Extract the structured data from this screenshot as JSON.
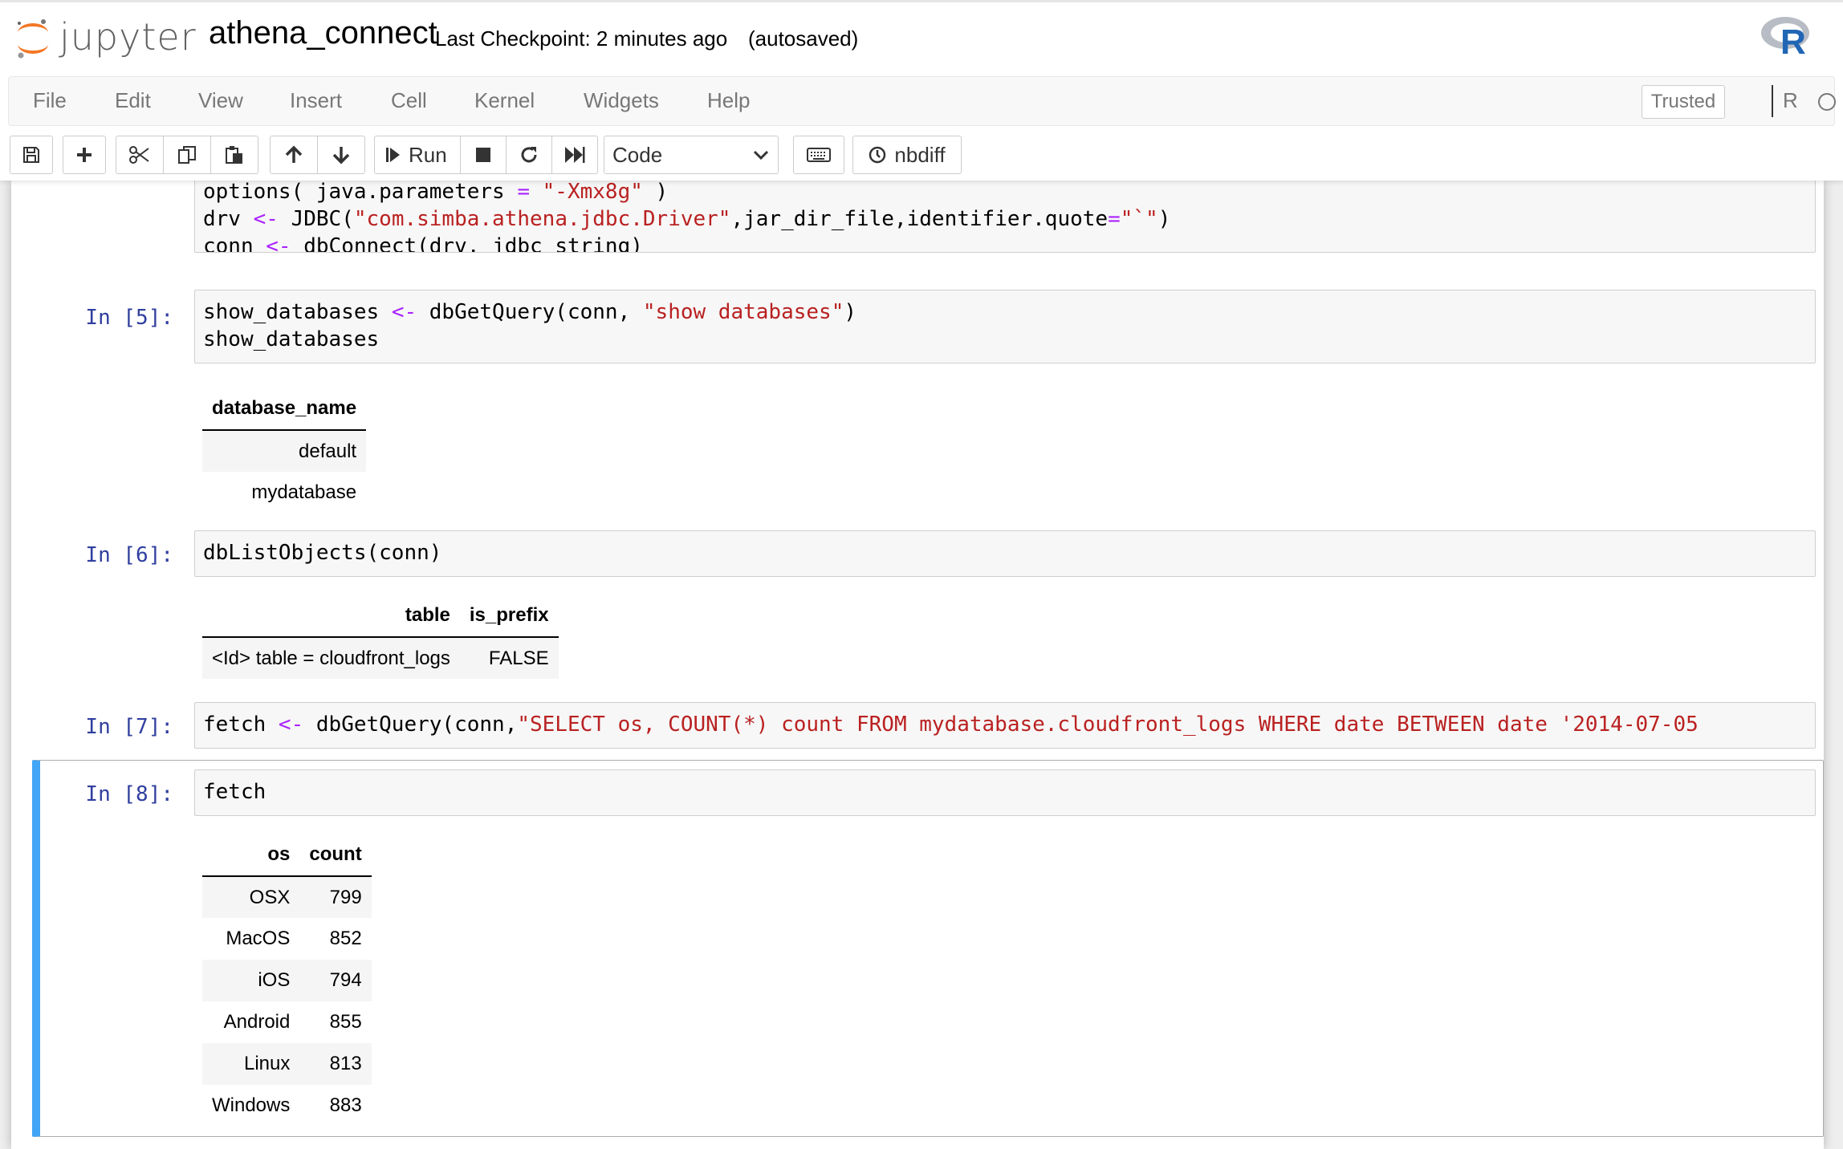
{
  "header": {
    "logo_text": "jupyter",
    "notebook_name": "athena_connect",
    "checkpoint": "Last Checkpoint: 2 minutes ago",
    "autosave": "(autosaved)",
    "kernel_logo_icon": "r-logo-icon"
  },
  "menubar": {
    "items": [
      "File",
      "Edit",
      "View",
      "Insert",
      "Cell",
      "Kernel",
      "Widgets",
      "Help"
    ],
    "trusted": "Trusted",
    "kernel_name": "R"
  },
  "toolbar": {
    "run_label": "Run",
    "cell_type": "Code",
    "nbdiff_label": "nbdiff"
  },
  "cells": {
    "c4": {
      "lines": [
        "options( java.parameters = \"-Xmx8g\" )",
        "drv <- JDBC(\"com.simba.athena.jdbc.Driver\",jar_dir_file,identifier.quote=\"`\")",
        "conn <- dbConnect(drv, jdbc_string)"
      ]
    },
    "c5": {
      "prompt": "In [5]:",
      "lines": [
        "show_databases <- dbGetQuery(conn, \"show databases\")",
        "show_databases"
      ],
      "output": {
        "columns": [
          "database_name"
        ],
        "rows": [
          [
            "default"
          ],
          [
            "mydatabase"
          ]
        ]
      }
    },
    "c6": {
      "prompt": "In [6]:",
      "lines": [
        "dbListObjects(conn)"
      ],
      "output": {
        "columns": [
          "table",
          "is_prefix"
        ],
        "rows": [
          [
            "<Id> table = cloudfront_logs",
            "FALSE"
          ]
        ]
      }
    },
    "c7": {
      "prompt": "In [7]:",
      "lines": [
        "fetch <- dbGetQuery(conn,\"SELECT os, COUNT(*) count FROM mydatabase.cloudfront_logs WHERE date BETWEEN date '2014-07-05"
      ]
    },
    "c8": {
      "prompt": "In [8]:",
      "lines": [
        "fetch"
      ],
      "output": {
        "columns": [
          "os",
          "count"
        ],
        "rows": [
          [
            "OSX",
            "799"
          ],
          [
            "MacOS",
            "852"
          ],
          [
            "iOS",
            "794"
          ],
          [
            "Android",
            "855"
          ],
          [
            "Linux",
            "813"
          ],
          [
            "Windows",
            "883"
          ]
        ]
      }
    }
  },
  "colors": {
    "prompt": "#303f9f",
    "keyword": "#aa22ff",
    "string": "#ba2121",
    "selected_cell_bar": "#42a5f5"
  }
}
